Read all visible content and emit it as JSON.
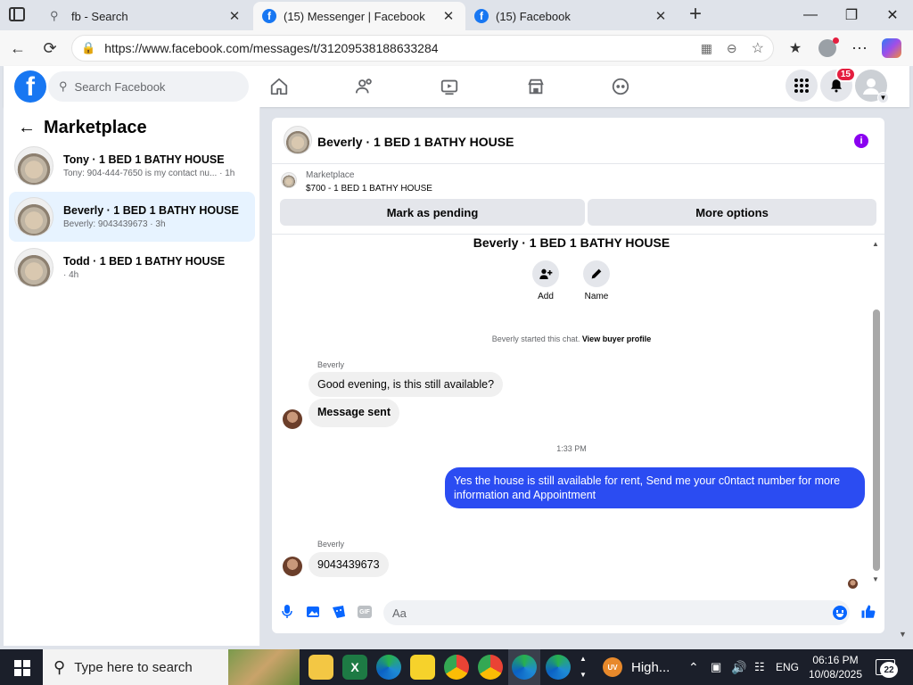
{
  "browser": {
    "tabs": [
      {
        "title": "fb - Search",
        "icon": "search-icon"
      },
      {
        "title": "(15) Messenger | Facebook",
        "icon": "facebook-icon"
      },
      {
        "title": "(15) Facebook",
        "icon": "facebook-icon"
      }
    ],
    "url": "https://www.facebook.com/messages/t/31209538188633284"
  },
  "fb": {
    "search_placeholder": "Search Facebook",
    "notification_count": "15"
  },
  "sidebar": {
    "title": "Marketplace",
    "conversations": [
      {
        "name": "Tony · 1 BED 1 BATHY HOUSE",
        "preview": "Tony: 904-444-7650 is my contact nu...",
        "time": "· 1h"
      },
      {
        "name": "Beverly · 1 BED 1 BATHY HOUSE",
        "preview": "Beverly: 9043439673 · 3h",
        "time": ""
      },
      {
        "name": "Todd · 1 BED 1 BATHY HOUSE",
        "preview": "· 4h",
        "time": ""
      }
    ]
  },
  "chat": {
    "header_title": "Beverly · 1 BED 1 BATHY HOUSE",
    "listing_label": "Marketplace",
    "listing_title": "$700 - 1 BED 1 BATHY HOUSE",
    "mark_pending": "Mark as pending",
    "more_options": "More options",
    "intro_title": "Beverly · 1 BED 1 BATHY HOUSE",
    "add_label": "Add",
    "name_label": "Name",
    "started_text": "Beverly started this chat.",
    "view_profile": "View buyer profile",
    "sender1": "Beverly",
    "msg1": "Good evening, is this still available?",
    "msg2": "Message sent",
    "timestamp": "1:33 PM",
    "msg_out": "Yes the house is still available for rent, Send me your c0ntact number for more information and Appointment",
    "sender2": "Beverly",
    "msg3": "9043439673",
    "composer_placeholder": "Aa"
  },
  "taskbar": {
    "search_placeholder": "Type here to search",
    "weather": "High...",
    "weather_badge": "UV",
    "lang": "ENG",
    "time": "06:16 PM",
    "date": "10/08/2025",
    "notif_count": "22"
  },
  "colors": {
    "fb_blue": "#1877f2",
    "outgoing_bubble": "#2b4cf2",
    "selected_conv": "#e7f3ff",
    "info_purple": "#8a00f0",
    "badge_red": "#e41e3f"
  }
}
